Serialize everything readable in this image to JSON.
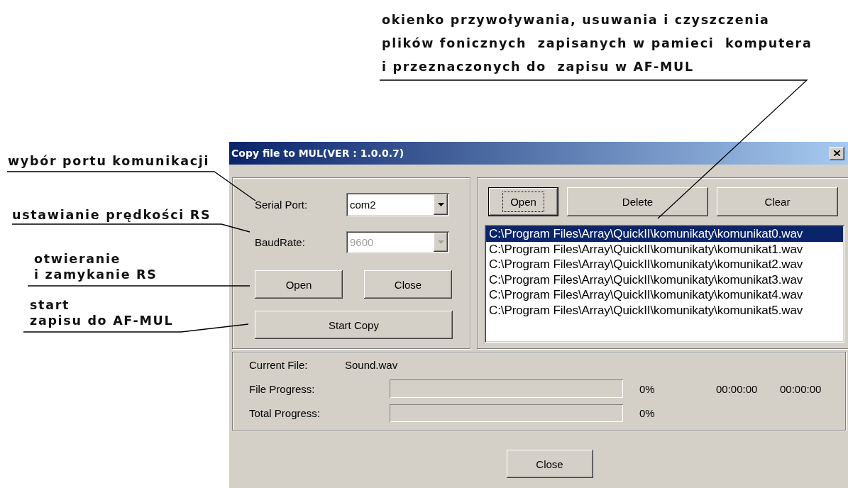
{
  "annotations": [
    {
      "text": "okienko przywoływania, usuwania i czyszczenia\nplików fonicznych  zapisanych w pamieci  komputera\ni przeznaczonych do  zapisu w AF-MUL"
    },
    {
      "text": "wybór portu komunikacji"
    },
    {
      "text": "ustawianie prędkości RS"
    },
    {
      "text": "otwieranie\ni zamykanie RS"
    },
    {
      "text": "start\nzapisu do AF-MUL"
    }
  ],
  "window": {
    "title": "Copy file to MUL(VER : 1.0.0.7)"
  },
  "serial_port": {
    "label": "Serial Port:",
    "value": "com2",
    "disabled": false
  },
  "baud_rate": {
    "label": "BaudRate:",
    "value": "9600",
    "disabled": true
  },
  "port_buttons": [
    {
      "label": "Open"
    },
    {
      "label": "Close"
    }
  ],
  "start_button": {
    "label": "Start Copy"
  },
  "file_buttons": [
    {
      "label": "Open",
      "focused": true
    },
    {
      "label": "Delete",
      "focused": false
    },
    {
      "label": "Clear",
      "focused": false
    }
  ],
  "files": [
    {
      "path": "C:\\Program Files\\Array\\QuickII\\komunikaty\\komunikat0.wav",
      "selected": true
    },
    {
      "path": "C:\\Program Files\\Array\\QuickII\\komunikaty\\komunikat1.wav",
      "selected": false
    },
    {
      "path": "C:\\Program Files\\Array\\QuickII\\komunikaty\\komunikat2.wav",
      "selected": false
    },
    {
      "path": "C:\\Program Files\\Array\\QuickII\\komunikaty\\komunikat3.wav",
      "selected": false
    },
    {
      "path": "C:\\Program Files\\Array\\QuickII\\komunikaty\\komunikat4.wav",
      "selected": false
    },
    {
      "path": "C:\\Program Files\\Array\\QuickII\\komunikaty\\komunikat5.wav",
      "selected": false
    }
  ],
  "current_file": {
    "label": "Current File:",
    "value": "Sound.wav"
  },
  "file_progress": {
    "label": "File Progress:",
    "level": 0,
    "percent": "0%",
    "times": [
      "00:00:00",
      "00:00:00"
    ]
  },
  "total_progress": {
    "label": "Total Progress:",
    "level": 0,
    "percent": "0%"
  },
  "close_button": {
    "label": "Close"
  }
}
